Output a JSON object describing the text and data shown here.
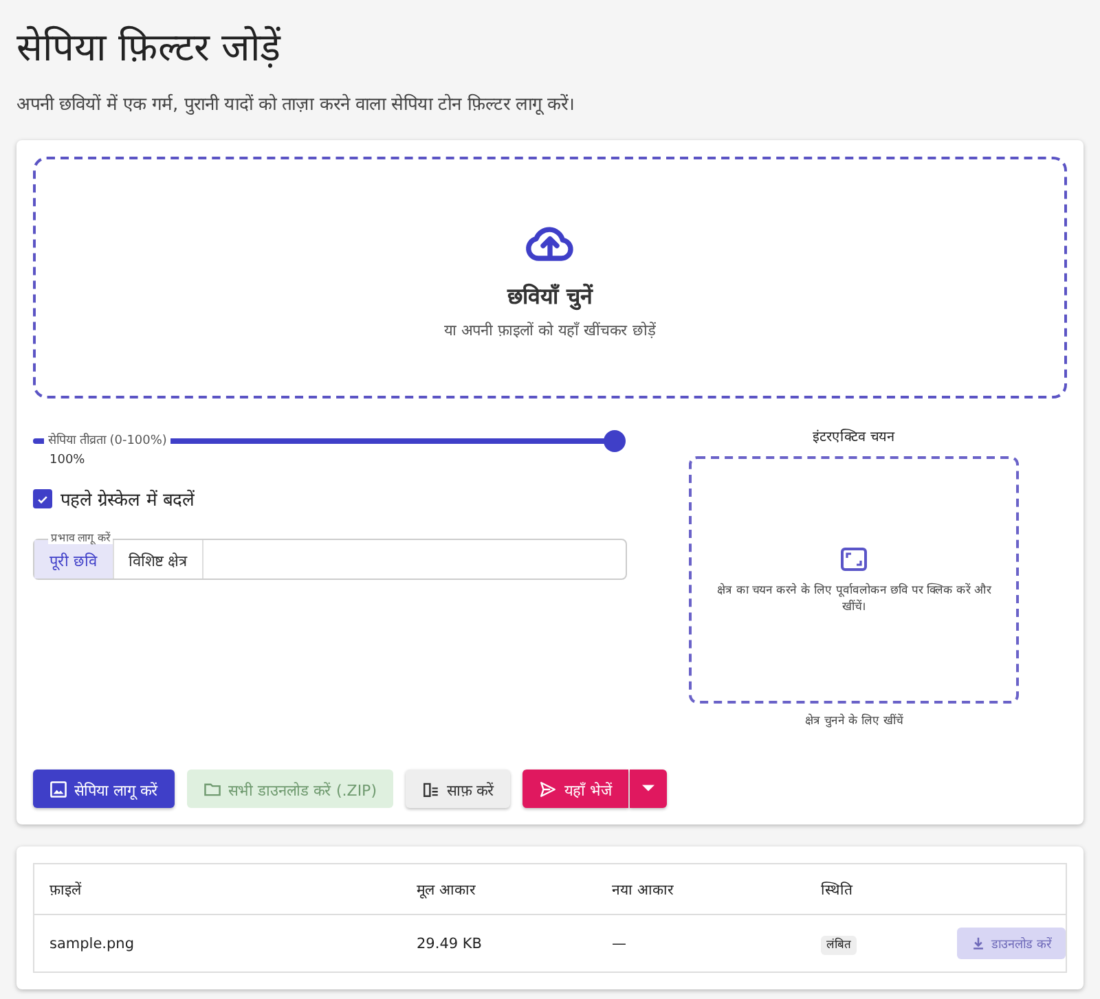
{
  "title": "सेपिया फ़िल्टर जोड़ें",
  "subtitle": "अपनी छवियों में एक गर्म, पुरानी यादों को ताज़ा करने वाला सेपिया टोन फ़िल्टर लागू करें।",
  "dropzone": {
    "heading": "छवियाँ चुनें",
    "hint": "या अपनी फ़ाइलों को यहाँ खींचकर छोड़ें"
  },
  "slider": {
    "label": "सेपिया तीव्रता (0-100%)",
    "level": 1.0,
    "reading": "100%"
  },
  "checkbox": {
    "label": "पहले ग्रेस्केल में बदलें",
    "checked": true
  },
  "apply_to": {
    "legend": "प्रभाव लागू करें",
    "options": [
      {
        "label": "पूरी छवि",
        "selected": true
      },
      {
        "label": "विशिष्ट क्षेत्र",
        "selected": false
      }
    ]
  },
  "interactive": {
    "title": "इंटरएक्टिव चयन",
    "message": "क्षेत्र का चयन करने के लिए पूर्वावलोकन छवि पर क्लिक करें और खींचें।",
    "caption": "क्षेत्र चुनने के लिए खींचें"
  },
  "buttons": [
    {
      "kind": "primary",
      "label": "सेपिया लागू करें"
    },
    {
      "kind": "download",
      "label": "सभी डाउनलोड करें (.ZIP)",
      "disabled": true
    },
    {
      "kind": "clear",
      "label": "साफ़ करें"
    },
    {
      "kind": "send",
      "label": "यहाँ भेजें"
    }
  ],
  "table": {
    "columns": [
      "फ़ाइलें",
      "मूल आकार",
      "नया आकार",
      "स्थिति"
    ],
    "rows": [
      {
        "file": "sample.png",
        "original_size": "29.49 KB",
        "new_size": "—",
        "status": "लंबित",
        "download": {
          "label": "डाउनलोड करें",
          "disabled": true
        }
      }
    ]
  }
}
